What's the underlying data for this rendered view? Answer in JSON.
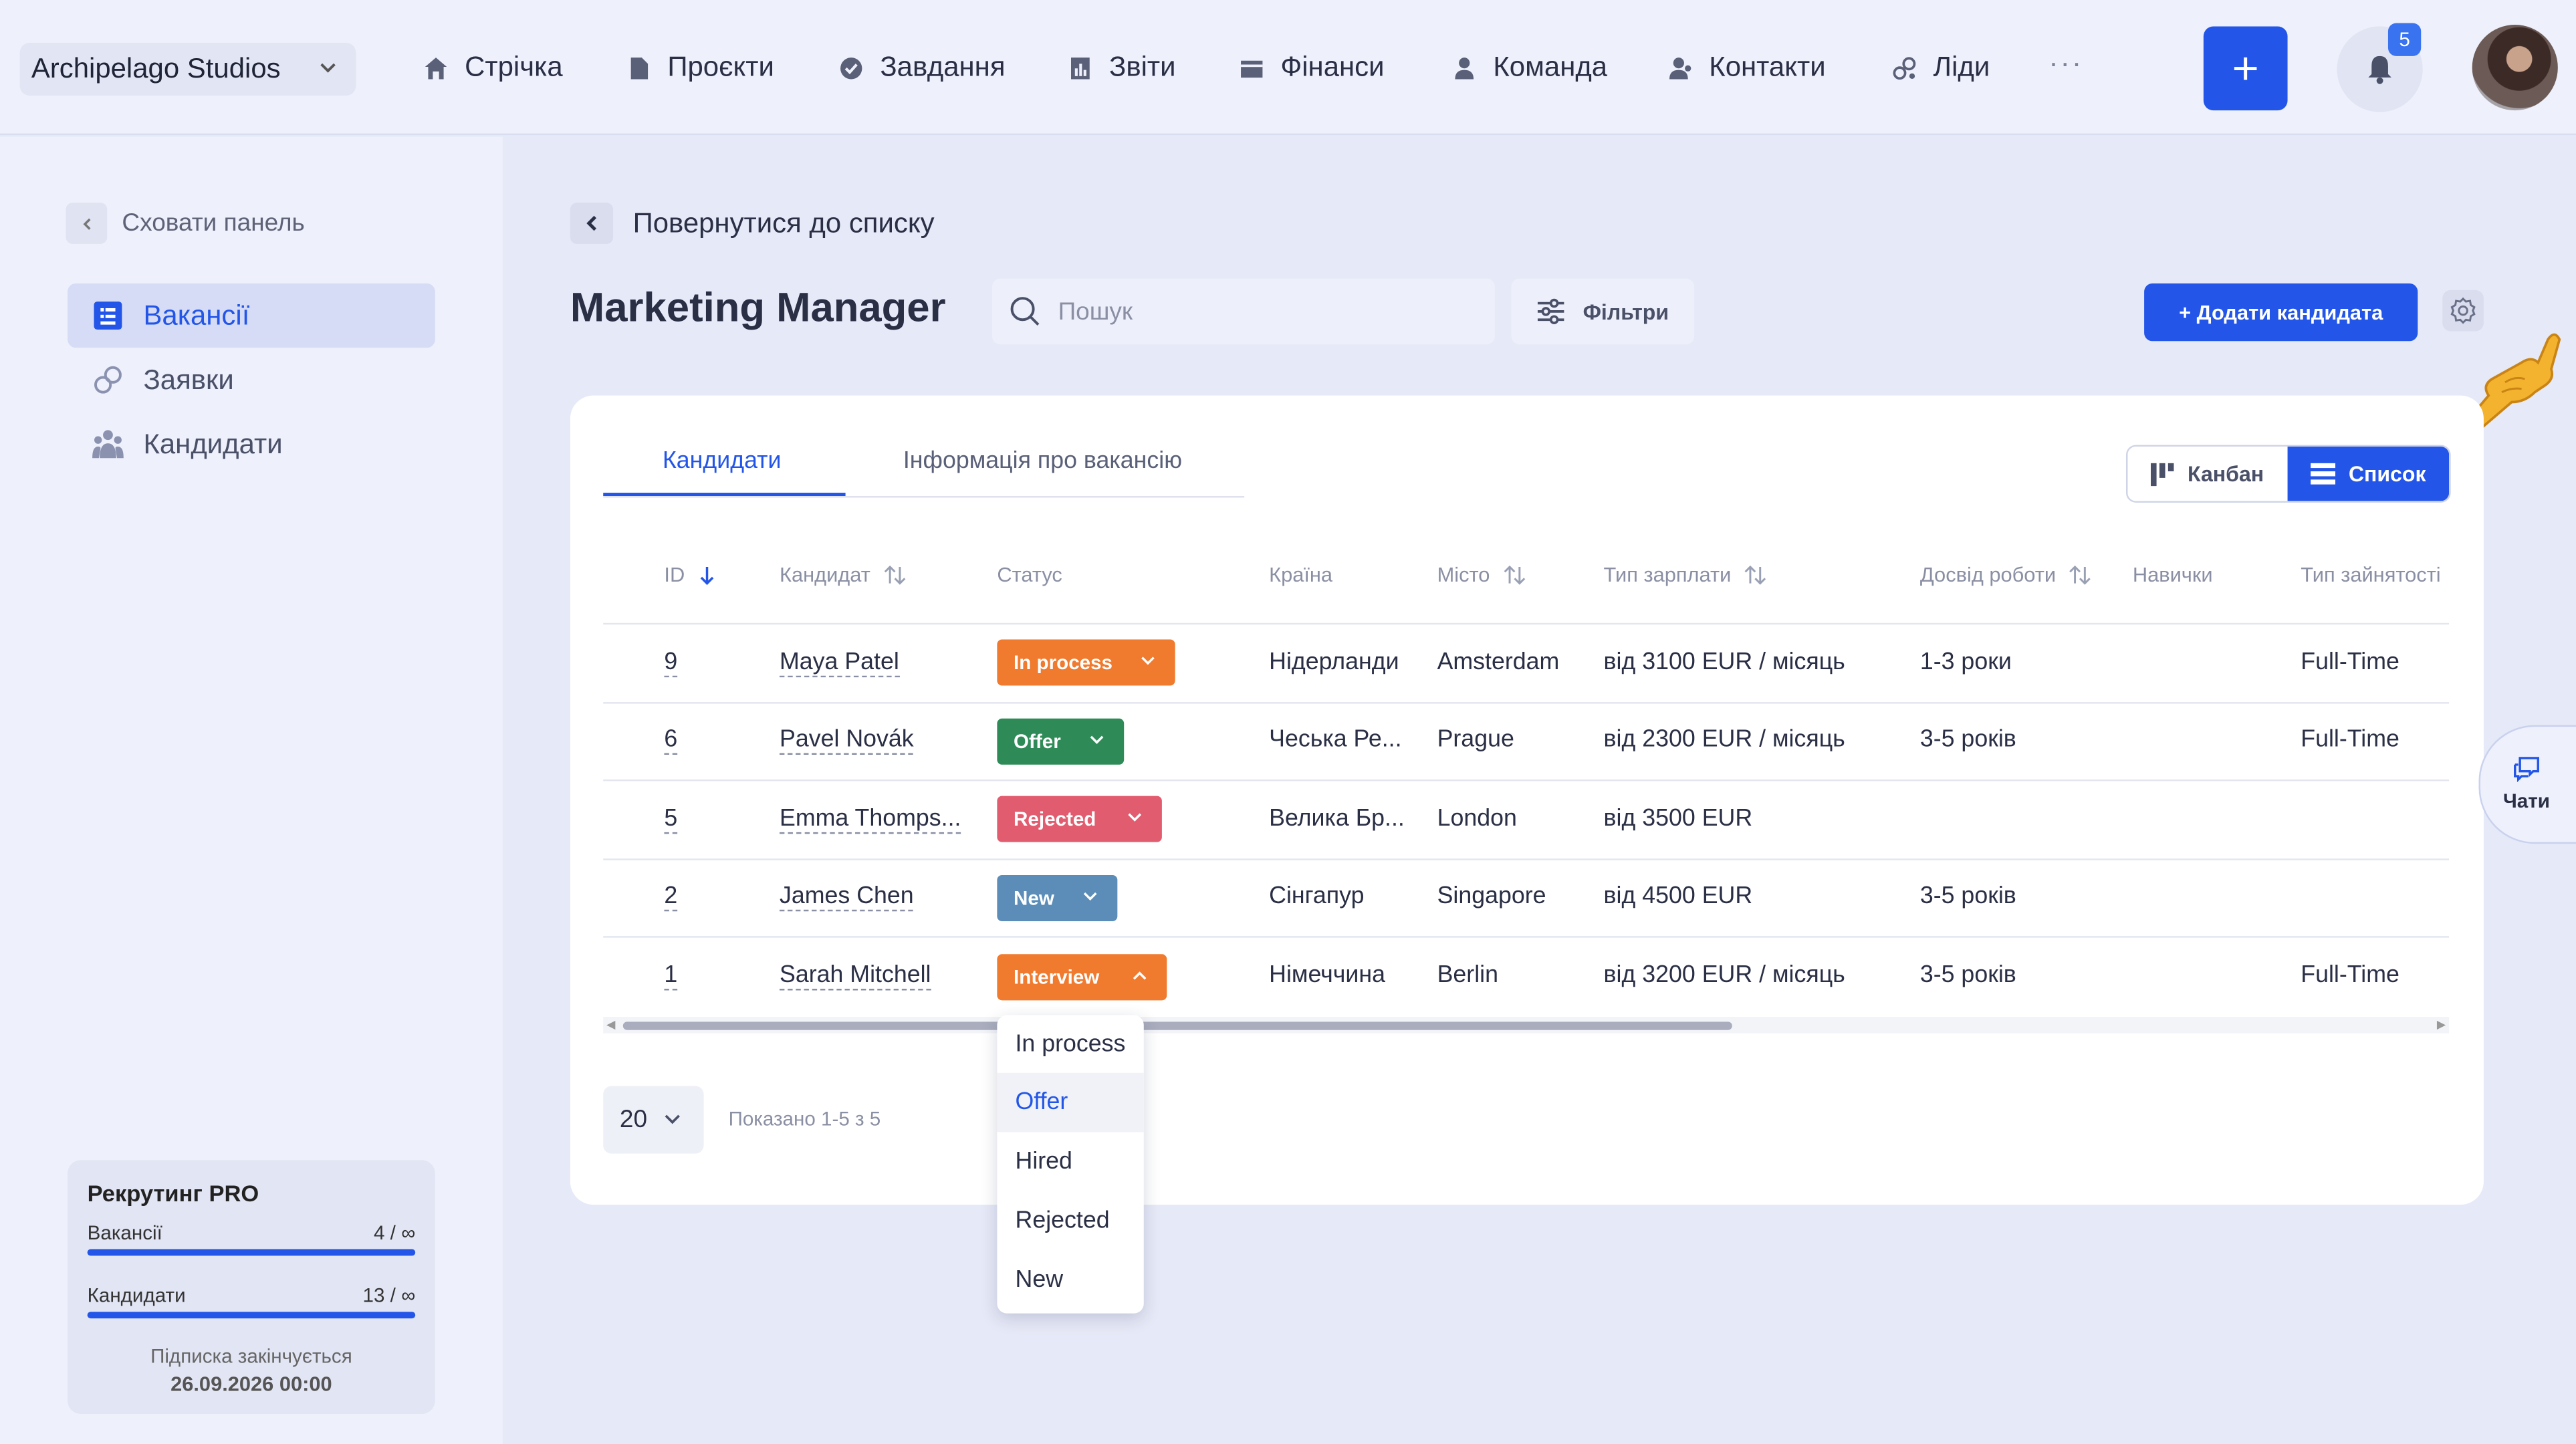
{
  "workspace": {
    "name": "Archipelago Studios"
  },
  "nav": {
    "items": [
      {
        "label": "Стрічка",
        "icon": "home-icon"
      },
      {
        "label": "Проєкти",
        "icon": "file-icon"
      },
      {
        "label": "Завдання",
        "icon": "check-circle-icon"
      },
      {
        "label": "Звіти",
        "icon": "report-icon"
      },
      {
        "label": "Фінанси",
        "icon": "wallet-icon"
      },
      {
        "label": "Команда",
        "icon": "person-icon"
      },
      {
        "label": "Контакти",
        "icon": "contacts-icon"
      },
      {
        "label": "Ліди",
        "icon": "leads-icon"
      }
    ],
    "more": "···",
    "add_label": "+",
    "notifications": "5"
  },
  "sidebar": {
    "hide_label": "Сховати панель",
    "items": [
      {
        "label": "Вакансії",
        "active": true
      },
      {
        "label": "Заявки",
        "active": false
      },
      {
        "label": "Кандидати",
        "active": false
      }
    ],
    "plan": {
      "title": "Рекрутинг PRO",
      "vacancies_label": "Вакансії",
      "vacancies_value": "4 / ∞",
      "candidates_label": "Кандидати",
      "candidates_value": "13 / ∞",
      "expires_label": "Підписка закінчується",
      "expires_date": "26.09.2026 00:00"
    }
  },
  "main": {
    "back_label": "Повернутися до списку",
    "title": "Marketing Manager",
    "search_placeholder": "Пошук",
    "filters_label": "Фільтри",
    "add_candidate_label": "+ Додати кандидата",
    "tabs": [
      {
        "label": "Кандидати",
        "active": true
      },
      {
        "label": "Інформація про вакансію",
        "active": false
      }
    ],
    "view": {
      "kanban_label": "Канбан",
      "list_label": "Список",
      "active": "list"
    },
    "columns": [
      "ID",
      "Кандидат",
      "Статус",
      "Країна",
      "Місто",
      "Тип зарплати",
      "Досвід роботи",
      "Навички",
      "Тип зайнятості"
    ],
    "rows": [
      {
        "id": "9",
        "name": "Maya Patel",
        "status": "In process",
        "country": "Нідерланди",
        "city": "Amsterdam",
        "salary": "від 3100 EUR / місяць",
        "experience": "1-3 роки",
        "skills": "",
        "employment": "Full-Time"
      },
      {
        "id": "6",
        "name": "Pavel Novák",
        "status": "Offer",
        "country": "Чеська Ре...",
        "city": "Prague",
        "salary": "від 2300 EUR / місяць",
        "experience": "3-5 років",
        "skills": "",
        "employment": "Full-Time"
      },
      {
        "id": "5",
        "name": "Emma Thomps...",
        "status": "Rejected",
        "country": "Велика Бр...",
        "city": "London",
        "salary": "від 3500 EUR",
        "experience": "",
        "skills": "",
        "employment": ""
      },
      {
        "id": "2",
        "name": "James Chen",
        "status": "New",
        "country": "Сінгапур",
        "city": "Singapore",
        "salary": "від 4500 EUR",
        "experience": "3-5 років",
        "skills": "",
        "employment": ""
      },
      {
        "id": "1",
        "name": "Sarah Mitchell",
        "status": "Interview",
        "country": "Німеччина",
        "city": "Berlin",
        "salary": "від 3200 EUR / місяць",
        "experience": "3-5 років",
        "skills": "",
        "employment": "Full-Time"
      }
    ],
    "status_colors": {
      "In process": "#f07a2e",
      "Offer": "#2e8b57",
      "Rejected": "#e25c6f",
      "New": "#5b8db8",
      "Interview": "#f07a2e"
    },
    "dropdown_options": [
      "In process",
      "Offer",
      "Hired",
      "Rejected",
      "New"
    ],
    "dropdown_highlighted": "Offer",
    "per_page": "20",
    "shown_text": "Показано 1-5 з 5"
  },
  "chats": {
    "label": "Чати"
  },
  "colors": {
    "accent": "#2356e8",
    "background": "#e6e9f7",
    "card": "#ffffff"
  }
}
